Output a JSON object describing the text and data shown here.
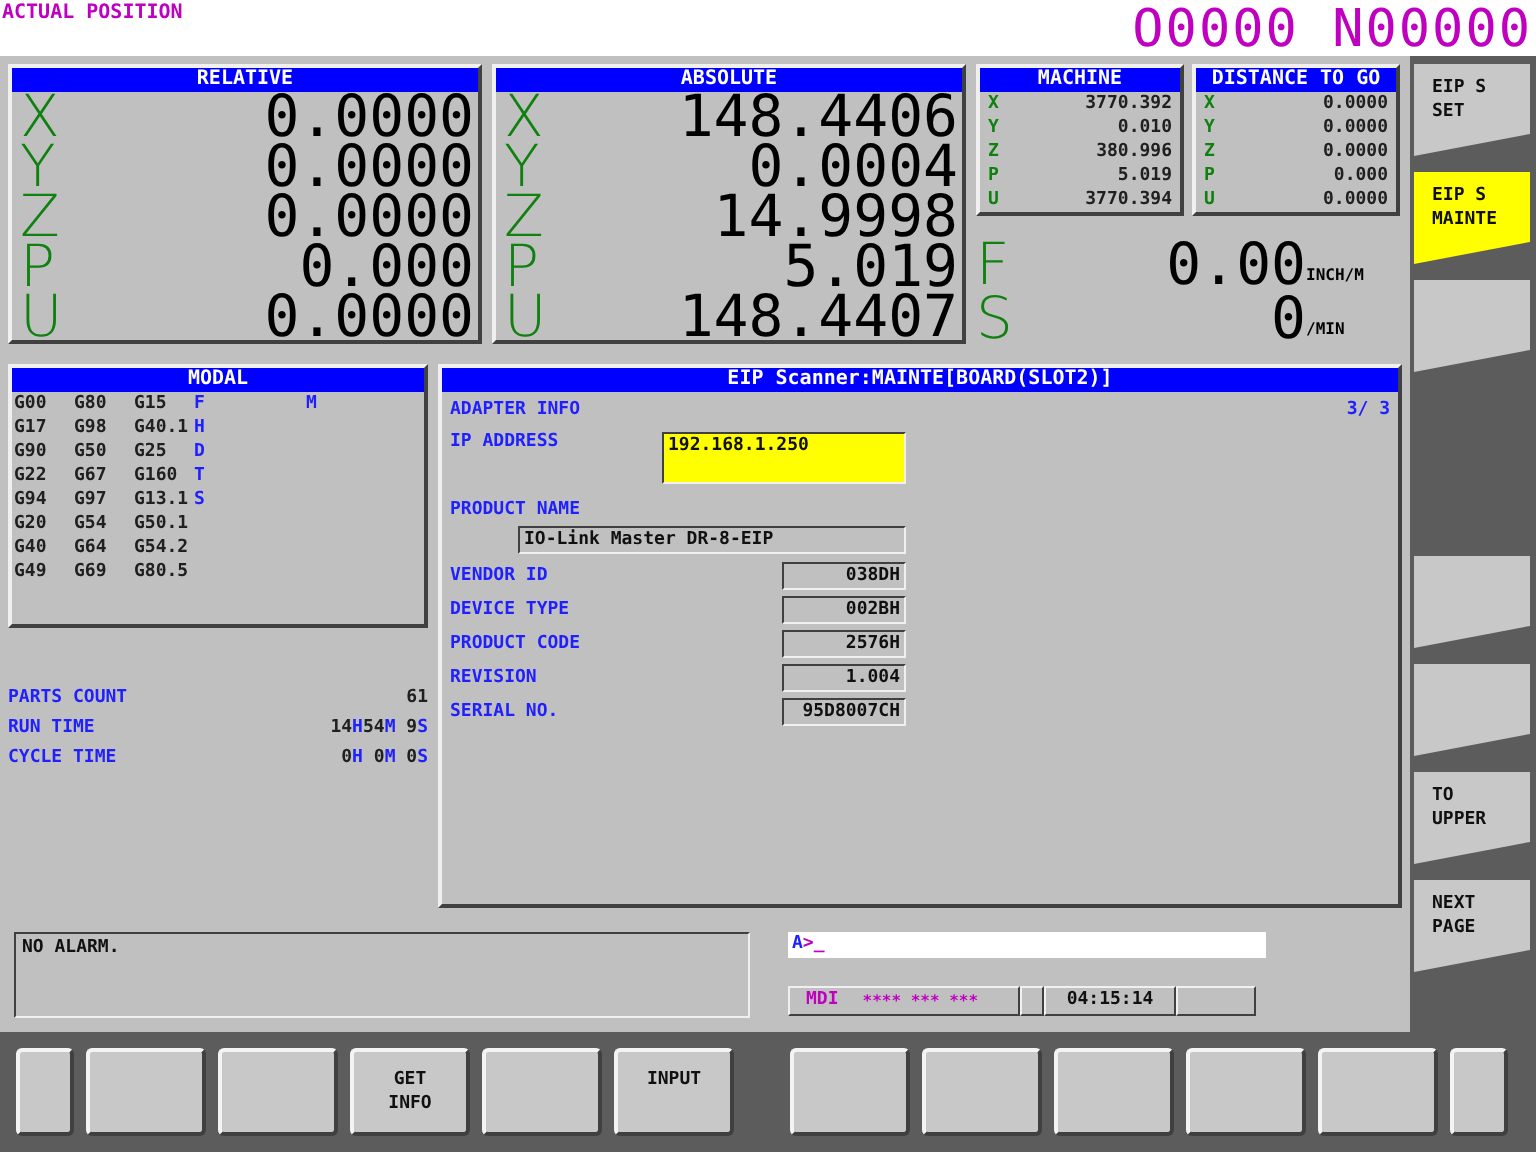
{
  "header": {
    "title": "ACTUAL POSITION",
    "program": "O0000 N00000"
  },
  "relative": {
    "title": "RELATIVE",
    "axes": [
      {
        "axis": "X",
        "value": "0.0000"
      },
      {
        "axis": "Y",
        "value": "0.0000"
      },
      {
        "axis": "Z",
        "value": "0.0000"
      },
      {
        "axis": "P",
        "value": "0.000"
      },
      {
        "axis": "U",
        "value": "0.0000"
      }
    ]
  },
  "absolute": {
    "title": "ABSOLUTE",
    "axes": [
      {
        "axis": "X",
        "value": "148.4406"
      },
      {
        "axis": "Y",
        "value": "0.0004"
      },
      {
        "axis": "Z",
        "value": "14.9998"
      },
      {
        "axis": "P",
        "value": "5.019"
      },
      {
        "axis": "U",
        "value": "148.4407"
      }
    ]
  },
  "machine": {
    "title": "MACHINE",
    "axes": [
      {
        "axis": "X",
        "value": "3770.392"
      },
      {
        "axis": "Y",
        "value": "0.010"
      },
      {
        "axis": "Z",
        "value": "380.996"
      },
      {
        "axis": "P",
        "value": "5.019"
      },
      {
        "axis": "U",
        "value": "3770.394"
      }
    ]
  },
  "distance_to_go": {
    "title": "DISTANCE TO GO",
    "axes": [
      {
        "axis": "X",
        "value": "0.0000"
      },
      {
        "axis": "Y",
        "value": "0.0000"
      },
      {
        "axis": "Z",
        "value": "0.0000"
      },
      {
        "axis": "P",
        "value": "0.000"
      },
      {
        "axis": "U",
        "value": "0.0000"
      }
    ]
  },
  "feed": {
    "label": "F",
    "value": "0.00",
    "unit": "INCH/M"
  },
  "spindle": {
    "label": "S",
    "value": "0",
    "unit": "/MIN"
  },
  "modal": {
    "title": "MODAL",
    "rows": [
      {
        "codes": [
          "G00",
          "G80",
          "G15"
        ],
        "address": "F",
        "extra": "M"
      },
      {
        "codes": [
          "G17",
          "G98",
          "G40.1"
        ],
        "address": "H"
      },
      {
        "codes": [
          "G90",
          "G50",
          "G25"
        ],
        "address": "D"
      },
      {
        "codes": [
          "G22",
          "G67",
          "G160"
        ],
        "address": "T"
      },
      {
        "codes": [
          "G94",
          "G97",
          "G13.1"
        ],
        "address": "S"
      },
      {
        "codes": [
          "G20",
          "G54",
          "G50.1"
        ]
      },
      {
        "codes": [
          "G40",
          "G64",
          "G54.2"
        ]
      },
      {
        "codes": [
          "G49",
          "G69",
          "G80.5"
        ]
      }
    ]
  },
  "counters": [
    {
      "label": "PARTS COUNT",
      "parts": [
        "61"
      ]
    },
    {
      "label": "RUN TIME",
      "parts": [
        "14",
        "H",
        "54",
        "M",
        " 9",
        "S"
      ]
    },
    {
      "label": "CYCLE TIME",
      "parts": [
        "0",
        "H",
        " 0",
        "M",
        " 0",
        "S"
      ]
    }
  ],
  "eip": {
    "title": "EIP Scanner:MAINTE[BOARD(SLOT2)]",
    "section": "ADAPTER INFO",
    "page": "3/ 3",
    "fields": [
      {
        "label": "IP ADDRESS",
        "value": "192.168.1.250",
        "kind": "edit",
        "selected": true
      },
      {
        "label": "PRODUCT NAME",
        "value": "IO-Link Master DR-8-EIP",
        "kind": "wide",
        "selected": false
      },
      {
        "label": "VENDOR ID",
        "value": "038DH",
        "kind": "short",
        "selected": false
      },
      {
        "label": "DEVICE TYPE",
        "value": "002BH",
        "kind": "short",
        "selected": false
      },
      {
        "label": "PRODUCT CODE",
        "value": "2576H",
        "kind": "short",
        "selected": false
      },
      {
        "label": "REVISION",
        "value": "1.004",
        "kind": "short",
        "selected": false
      },
      {
        "label": "SERIAL NO.",
        "value": "95D8007CH",
        "kind": "short",
        "selected": false
      }
    ]
  },
  "alarm": "NO ALARM.",
  "input_line": {
    "channel": "A",
    "prompt": ">_"
  },
  "status_bar": {
    "mode": "MDI",
    "status": "**** *** ***",
    "time": "04:15:14"
  },
  "side_keys": [
    {
      "kind": "key",
      "lines": [
        "EIP S",
        "SET"
      ],
      "selected": false
    },
    {
      "kind": "key",
      "lines": [
        "EIP S",
        "MAINTE"
      ],
      "selected": true
    },
    {
      "kind": "key",
      "selected": false
    },
    {
      "kind": "spacer"
    },
    {
      "kind": "key",
      "selected": false
    },
    {
      "kind": "key",
      "selected": false
    },
    {
      "kind": "key",
      "lines": [
        "TO",
        "UPPER"
      ],
      "selected": false
    },
    {
      "kind": "key",
      "lines": [
        "NEXT",
        "PAGE"
      ],
      "selected": false
    }
  ],
  "bottom_keys": [
    {
      "kind": "end"
    },
    {
      "kind": "key"
    },
    {
      "kind": "key"
    },
    {
      "kind": "key",
      "lines": [
        "GET",
        "INFO"
      ]
    },
    {
      "kind": "key"
    },
    {
      "kind": "key",
      "lines": [
        "INPUT"
      ]
    },
    {
      "kind": "spacer"
    },
    {
      "kind": "key"
    },
    {
      "kind": "key"
    },
    {
      "kind": "key"
    },
    {
      "kind": "key"
    },
    {
      "kind": "key"
    },
    {
      "kind": "end"
    }
  ]
}
